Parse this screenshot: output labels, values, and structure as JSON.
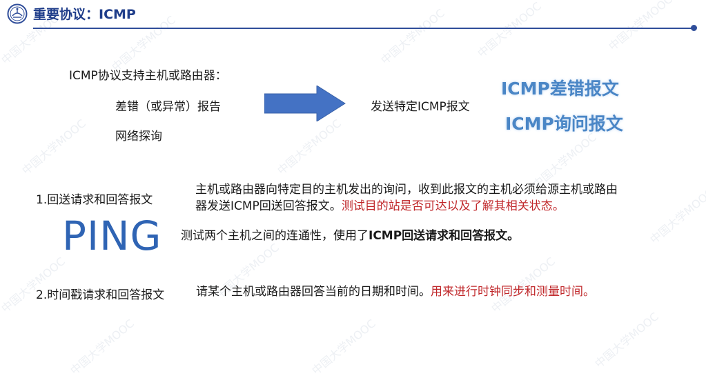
{
  "header": {
    "title": "重要协议：ICMP"
  },
  "intro": {
    "lead": "ICMP协议支持主机或路由器：",
    "items": [
      "差错（或异常）报告",
      "网络探询"
    ],
    "result": "发送特定ICMP报文",
    "types": [
      "ICMP差错报文",
      "ICMP询问报文"
    ]
  },
  "section1": {
    "label": "1.回送请求和回答报文",
    "desc_line1": "主机或路由器向特定目的主机发出的询问，收到此报文的主机必须给源主机或路由",
    "desc_line2_normal": "器发送ICMP回送回答报文。",
    "desc_line2_red": "测试目的站是否可达以及了解其相关状态。"
  },
  "ping": {
    "word": "PING",
    "desc_normal": "测试两个主机之间的连通性，使用了",
    "desc_bold": "ICMP回送请求和回答报文。"
  },
  "section2": {
    "label": "2.时间戳请求和回答报文",
    "desc_normal": "请某个主机或路由器回答当前的日期和时间。",
    "desc_red": "用来进行时钟同步和测量时间。"
  },
  "watermark": {
    "text": "中国大学MOOC"
  },
  "colors": {
    "title": "#1f3d8a",
    "arrow": "#4472c4",
    "accent_blue": "#4a86c6",
    "ping": "#2f64b4",
    "red": "#c0282b"
  },
  "icons": {
    "logo": "university-emblem-icon",
    "arrow": "right-arrow-icon"
  }
}
